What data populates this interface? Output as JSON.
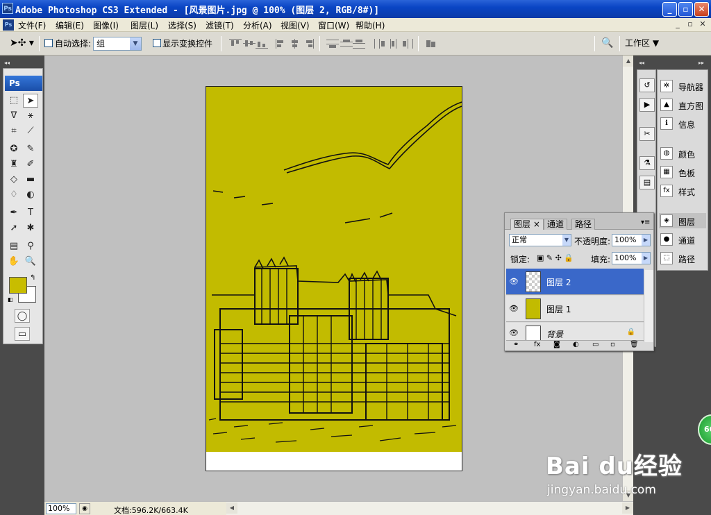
{
  "window": {
    "title": "Adobe Photoshop CS3 Extended - [风景图片.jpg @ 100% (图层 2, RGB/8#)]",
    "app_icon": "Ps",
    "buttons": {
      "minimize": "_",
      "maximize": "▫",
      "close": "✕"
    }
  },
  "menu": {
    "items": [
      "文件(F)",
      "编辑(E)",
      "图像(I)",
      "图层(L)",
      "选择(S)",
      "滤镜(T)",
      "分析(A)",
      "视图(V)",
      "窗口(W)",
      "帮助(H)"
    ]
  },
  "options": {
    "auto_select_label": "自动选择:",
    "auto_select_value": "组",
    "show_transform_label": "显示变换控件",
    "workspace_label": "工作区 ▼"
  },
  "tools": {
    "logo": "Ps",
    "foreground_color": "#c8bd00",
    "background_color": "#ffffff"
  },
  "panels": {
    "group1": [
      "导航器",
      "直方图",
      "信息"
    ],
    "group2": [
      "颜色",
      "色板",
      "样式"
    ],
    "group3": [
      "图层",
      "通道",
      "路径"
    ]
  },
  "layers_panel": {
    "tabs": [
      "图层 ×",
      "通道",
      "路径"
    ],
    "blend_mode": "正常",
    "opacity_label": "不透明度:",
    "opacity_value": "100%",
    "lock_label": "锁定:",
    "fill_label": "填充:",
    "fill_value": "100%",
    "layers": [
      {
        "name": "图层 2",
        "selected": true
      },
      {
        "name": "图层 1",
        "selected": false
      },
      {
        "name": "背景",
        "selected": false
      }
    ]
  },
  "status": {
    "zoom": "100%",
    "doc_info": "文档:596.2K/663.4K"
  },
  "watermark": {
    "brand": "Bai du经验",
    "url": "jingyan.baidu.com",
    "badge": "66"
  },
  "colors": {
    "canvas_fill": "#c2bb00",
    "selection_blue": "#3a68c9"
  }
}
